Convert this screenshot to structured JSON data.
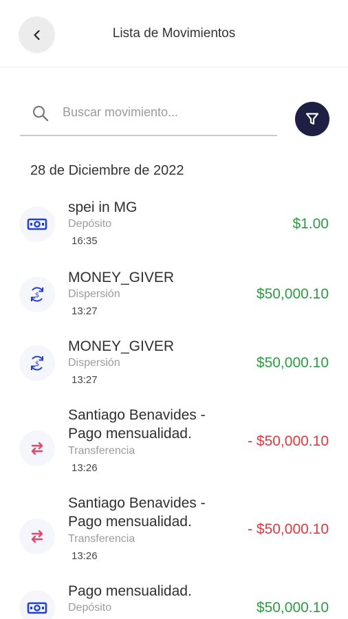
{
  "header": {
    "title": "Lista de Movimientos",
    "back_icon": "chevron-left-icon"
  },
  "search": {
    "placeholder": "Buscar movimiento...",
    "value": ""
  },
  "filter": {
    "icon": "filter-icon"
  },
  "colors": {
    "positive": "#2a9d3f",
    "negative": "#e0393e",
    "filter_bg": "#1d1f44",
    "icon_blue": "#1f3fd6",
    "icon_pink": "#e8456b"
  },
  "date_group": "28 de Diciembre de 2022",
  "transactions": [
    {
      "name_lines": [
        "spei in MG"
      ],
      "type": "Depósito",
      "time": "16:35",
      "amount": "$1.00",
      "icon": "cash-icon",
      "sign": "positive"
    },
    {
      "name_lines": [
        "MONEY_GIVER"
      ],
      "type": "Dispersión",
      "time": "13:27",
      "amount": "$50,000.10",
      "icon": "dollar-cycle-icon",
      "sign": "positive"
    },
    {
      "name_lines": [
        "MONEY_GIVER"
      ],
      "type": "Dispersión",
      "time": "13:27",
      "amount": "$50,000.10",
      "icon": "dollar-cycle-icon",
      "sign": "positive"
    },
    {
      "name_lines": [
        "Santiago Benavides -",
        "Pago mensualidad."
      ],
      "type": "Transferencia",
      "time": "13:26",
      "amount": "- $50,000.10",
      "icon": "transfer-arrows-icon",
      "sign": "negative"
    },
    {
      "name_lines": [
        "Santiago Benavides -",
        "Pago mensualidad."
      ],
      "type": "Transferencia",
      "time": "13:26",
      "amount": "- $50,000.10",
      "icon": "transfer-arrows-icon",
      "sign": "negative"
    },
    {
      "name_lines": [
        "Pago mensualidad."
      ],
      "type": "Depósito",
      "time": "",
      "amount": "$50,000.10",
      "icon": "cash-icon",
      "sign": "positive"
    }
  ]
}
